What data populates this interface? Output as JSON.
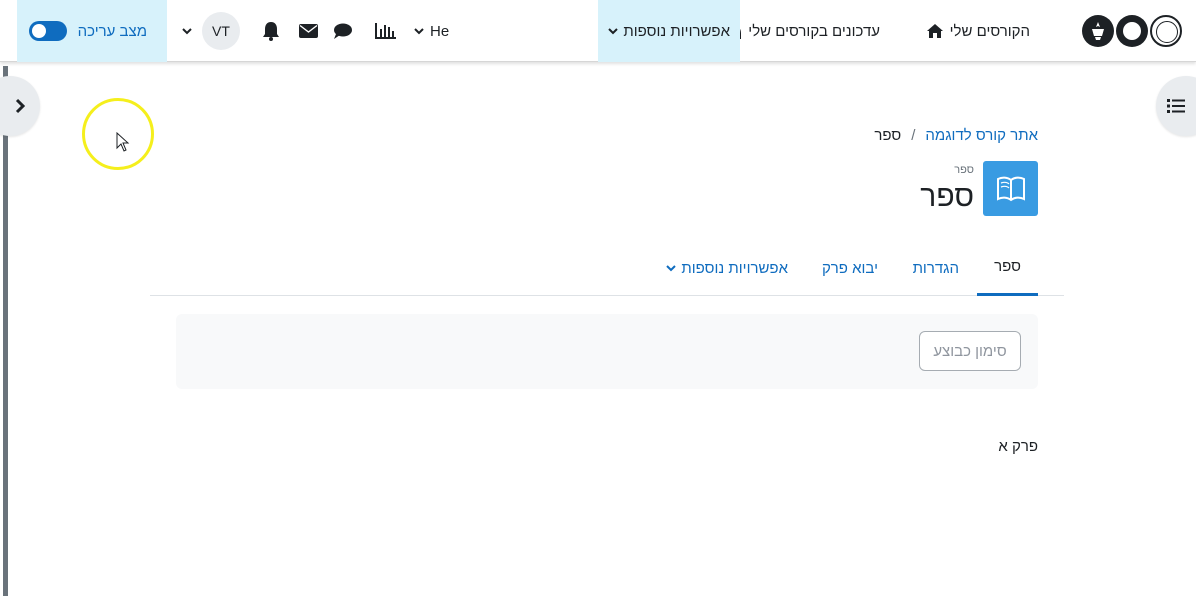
{
  "navbar": {
    "my_courses": "הקורסים שלי",
    "course_updates": "עדכונים בקורסים שלי",
    "more_options": "אפשרויות נוספות",
    "language": "He",
    "avatar_initials": "VT",
    "edit_mode_label": "מצב עריכה"
  },
  "breadcrumb": {
    "course": "אתר קורס לדוגמה",
    "separator": "/",
    "current": "ספר"
  },
  "page": {
    "activity_type": "ספר",
    "title": "ספר"
  },
  "tabs": {
    "book": "ספר",
    "settings": "הגדרות",
    "import_chapter": "יבוא פרק",
    "more": "אפשרויות נוספות"
  },
  "completion": {
    "mark_done": "סימון כבוצע"
  },
  "content": {
    "chapter": "פרק א"
  },
  "colors": {
    "accent": "#0f6cbf",
    "highlight": "#d7f2fb",
    "book_icon_bg": "#399be2"
  }
}
